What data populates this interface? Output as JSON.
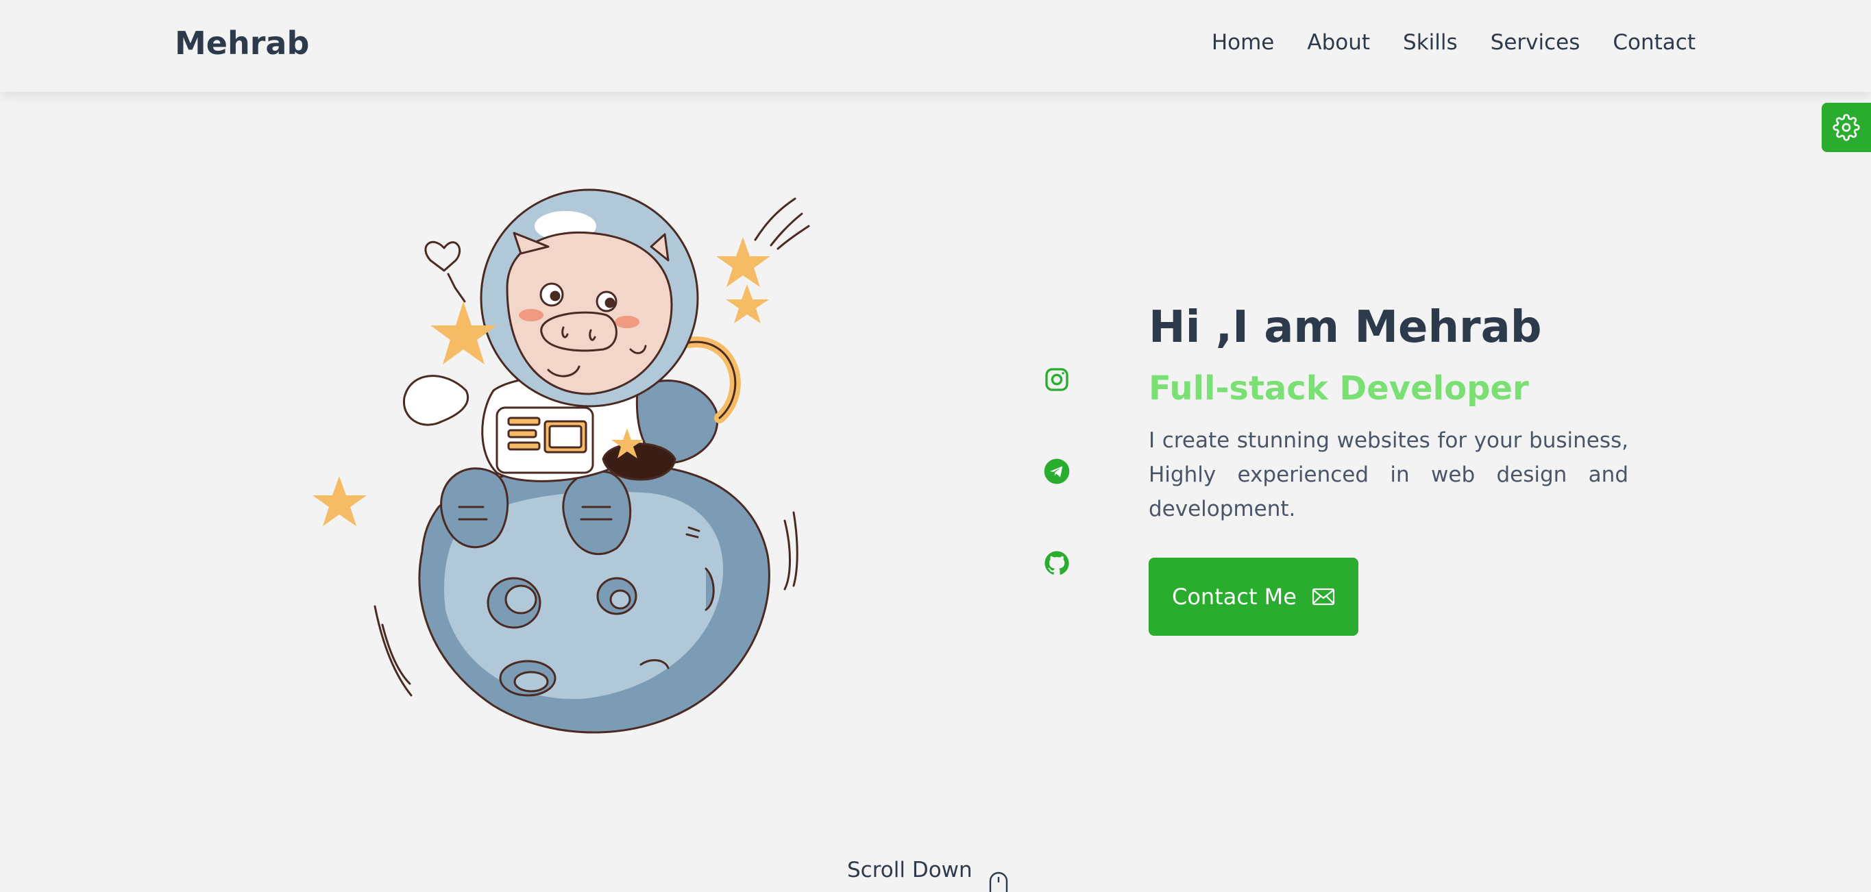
{
  "header": {
    "logo": "Mehrab",
    "nav": [
      "Home",
      "About",
      "Skills",
      "Services",
      "Contact"
    ]
  },
  "hero": {
    "title": "Hi ,I am Mehrab",
    "subtitle": "Full-stack Developer",
    "description": "I create stunning websites for your business, Highly experienced in web design and development.",
    "cta_label": "Contact Me"
  },
  "socials": [
    "instagram-icon",
    "telegram-icon",
    "github-icon"
  ],
  "scroll_label": "Scroll Down",
  "colors": {
    "accent": "#2aad2e",
    "subtitle": "#7be074",
    "text": "#2d3a4b",
    "background": "#f3f3f3"
  }
}
